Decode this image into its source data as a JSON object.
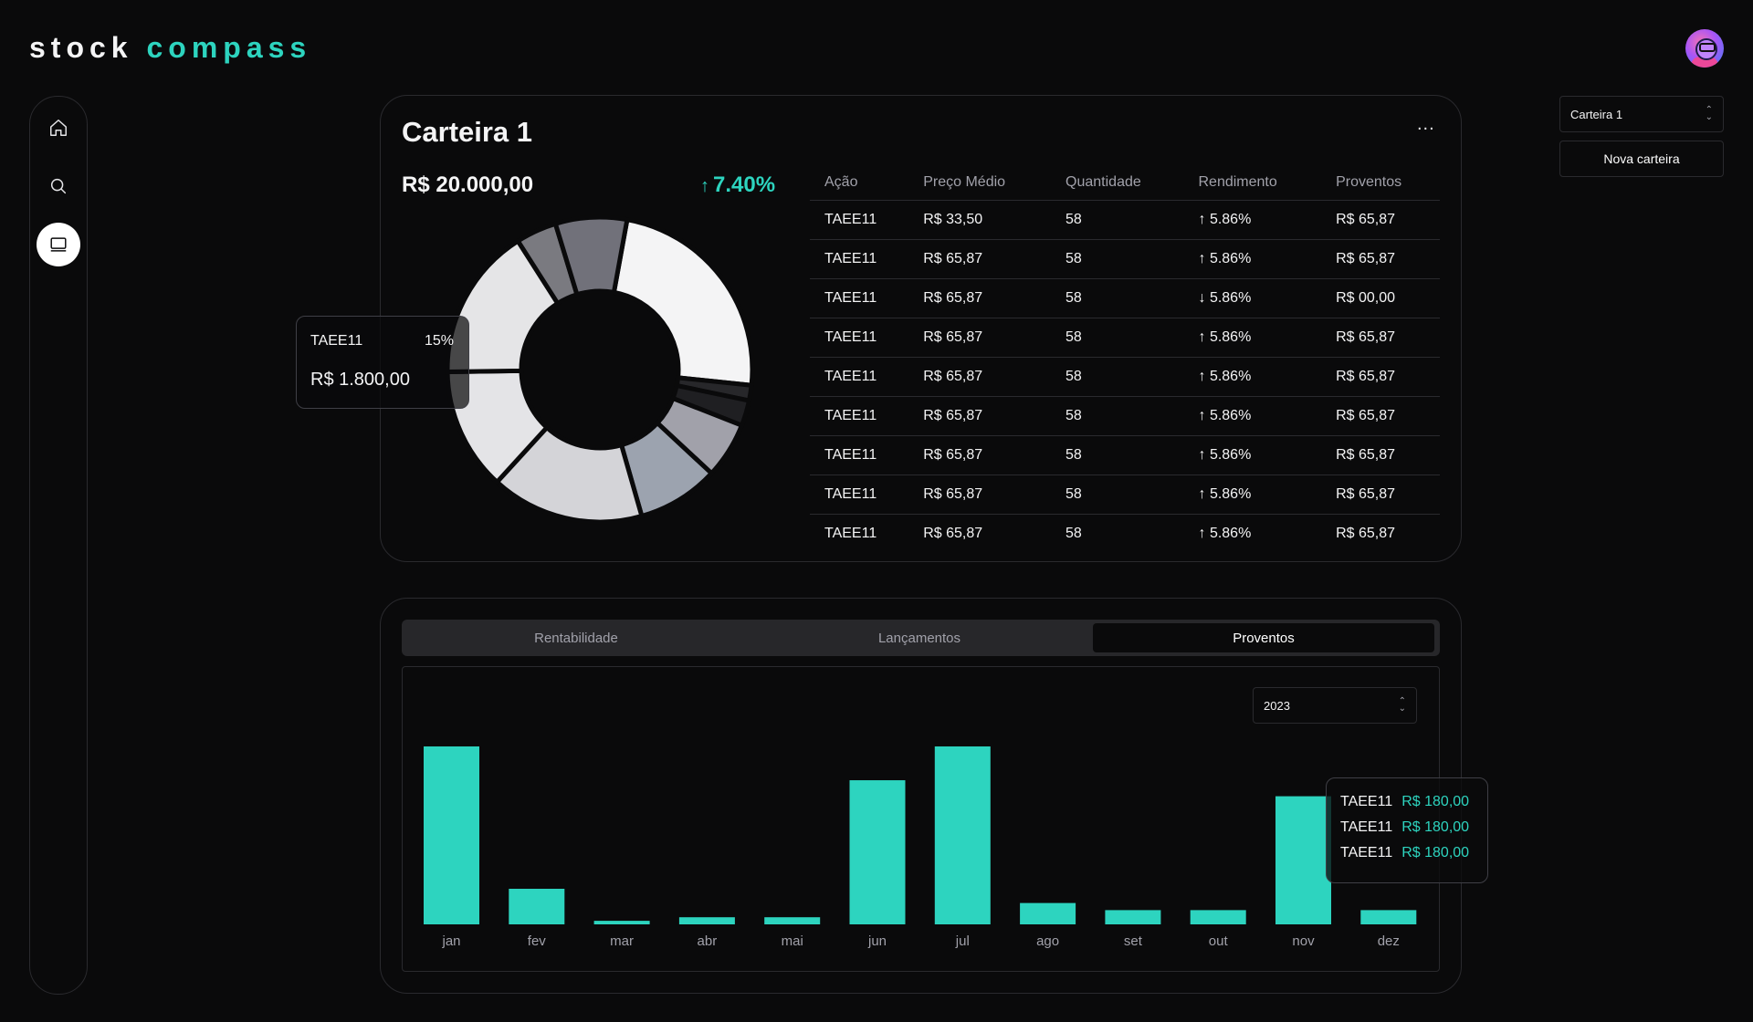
{
  "logo": {
    "part1": "stock",
    "part2": "compass"
  },
  "sidebar": {
    "items": [
      {
        "name": "home"
      },
      {
        "name": "search"
      },
      {
        "name": "wallet"
      }
    ]
  },
  "wallet": {
    "title": "Carteira 1",
    "total": "R$ 20.000,00",
    "performance": "7.40%",
    "more": "..."
  },
  "pie_tooltip": {
    "ticker": "TAEE11",
    "pct": "15%",
    "value": "R$ 1.800,00"
  },
  "allocation": {
    "slices": [
      {
        "value": 22,
        "color": "#f4f4f5"
      },
      {
        "value": 1.5,
        "color": "#27272a"
      },
      {
        "value": 2.5,
        "color": "#1f1f22"
      },
      {
        "value": 5.5,
        "color": "#a1a1aa"
      },
      {
        "value": 8,
        "color": "#9ca3af"
      },
      {
        "value": 15,
        "color": "#d4d4d8"
      },
      {
        "value": 12,
        "color": "#e4e4e7"
      },
      {
        "value": 15,
        "color": "#e5e5e7"
      },
      {
        "value": 4,
        "color": "#7a7a80"
      },
      {
        "value": 7,
        "color": "#71717a"
      }
    ]
  },
  "table": {
    "headers": [
      "Ação",
      "Preço Médio",
      "Quantidade",
      "Rendimento",
      "Proventos"
    ],
    "rows": [
      {
        "ticker": "TAEE11",
        "price": "R$ 33,50",
        "qty": "58",
        "yield": "5.86%",
        "dir": "up",
        "income": "R$ 65,87"
      },
      {
        "ticker": "TAEE11",
        "price": "R$ 65,87",
        "qty": "58",
        "yield": "5.86%",
        "dir": "up",
        "income": "R$ 65,87"
      },
      {
        "ticker": "TAEE11",
        "price": "R$ 65,87",
        "qty": "58",
        "yield": "5.86%",
        "dir": "down",
        "income": "R$ 00,00"
      },
      {
        "ticker": "TAEE11",
        "price": "R$ 65,87",
        "qty": "58",
        "yield": "5.86%",
        "dir": "up",
        "income": "R$ 65,87"
      },
      {
        "ticker": "TAEE11",
        "price": "R$ 65,87",
        "qty": "58",
        "yield": "5.86%",
        "dir": "up",
        "income": "R$ 65,87"
      },
      {
        "ticker": "TAEE11",
        "price": "R$ 65,87",
        "qty": "58",
        "yield": "5.86%",
        "dir": "up",
        "income": "R$ 65,87"
      },
      {
        "ticker": "TAEE11",
        "price": "R$ 65,87",
        "qty": "58",
        "yield": "5.86%",
        "dir": "up",
        "income": "R$ 65,87"
      },
      {
        "ticker": "TAEE11",
        "price": "R$ 65,87",
        "qty": "58",
        "yield": "5.86%",
        "dir": "up",
        "income": "R$ 65,87"
      },
      {
        "ticker": "TAEE11",
        "price": "R$ 65,87",
        "qty": "58",
        "yield": "5.86%",
        "dir": "up",
        "income": "R$ 65,87"
      }
    ]
  },
  "tabs": [
    {
      "label": "Rentabilidade",
      "active": false
    },
    {
      "label": "Lançamentos",
      "active": false
    },
    {
      "label": "Proventos",
      "active": true
    }
  ],
  "year_select": {
    "value": "2023"
  },
  "bar_tooltip": {
    "rows": [
      {
        "ticker": "TAEE11",
        "value": "R$ 180,00"
      },
      {
        "ticker": "TAEE11",
        "value": "R$ 180,00"
      },
      {
        "ticker": "TAEE11",
        "value": "R$ 180,00"
      }
    ]
  },
  "chart_data": {
    "type": "bar",
    "categories": [
      "jan",
      "fev",
      "mar",
      "abr",
      "mai",
      "jun",
      "jul",
      "ago",
      "set",
      "out",
      "nov",
      "dez"
    ],
    "values": [
      100,
      20,
      2,
      4,
      4,
      81,
      100,
      12,
      8,
      8,
      72,
      8
    ],
    "color": "#2dd4bf"
  },
  "right_panel": {
    "wallet_select": "Carteira 1",
    "new_wallet": "Nova carteira"
  },
  "colors": {
    "accent": "#2dd4bf",
    "negative": "#f59e0b",
    "background": "#0a0a0b"
  }
}
